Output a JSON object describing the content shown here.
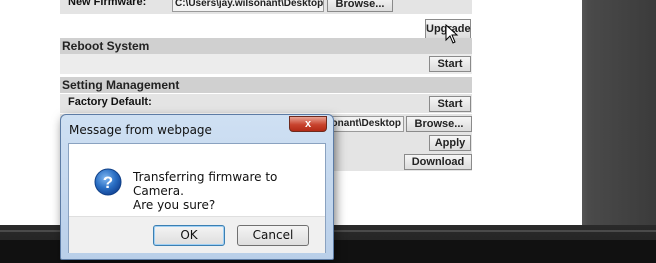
{
  "firmware": {
    "label": "New Firmware:",
    "path": "C:\\Users\\jay.wilsonant\\Desktop",
    "browse_label": "Browse...",
    "upgrade_label": "Upgrade"
  },
  "reboot": {
    "title": "Reboot System",
    "start_label": "Start"
  },
  "setting_management": {
    "title": "Setting Management",
    "factory_default_label": "Factory Default:",
    "factory_start_label": "Start",
    "path": "sonant\\Desktop",
    "browse_label": "Browse...",
    "apply_label": "Apply",
    "download_label": "Download"
  },
  "dialog": {
    "title": "Message from webpage",
    "close_glyph": "x",
    "message_line1": "Transferring firmware to Camera.",
    "message_line2": "Are you sure?",
    "ok_label": "OK",
    "cancel_label": "Cancel",
    "icon": "question-icon"
  },
  "colors": {
    "section_bar": "#d0d0d0",
    "row_bg": "#e4e4e4",
    "dialog_close": "#c8432e",
    "question_icon": "#1f5fb0"
  }
}
